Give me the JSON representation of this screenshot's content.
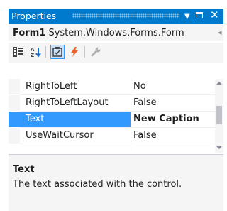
{
  "window": {
    "title": "Properties",
    "menu_glyph": "▼",
    "maximize_glyph": "□",
    "close_glyph": "✕"
  },
  "object_selector": {
    "name": "Form1",
    "type": "System.Windows.Forms.Form",
    "overflow_glyph": "◂"
  },
  "toolbar": {
    "buttons": [
      {
        "icon": "categorized-icon",
        "checked": false
      },
      {
        "icon": "alphabetical-icon",
        "checked": false
      },
      {
        "icon": "properties-icon",
        "checked": true
      },
      {
        "icon": "events-lightning-icon",
        "checked": false
      },
      {
        "icon": "property-pages-wrench-icon",
        "checked": false
      }
    ],
    "lightning_color": "#e8622a",
    "checked_border": "#3399ff",
    "checked_fill": "#c9e0f7"
  },
  "properties": [
    {
      "name": "RightToLeft",
      "value": "No",
      "selected": false
    },
    {
      "name": "RightToLeftLayout",
      "value": "False",
      "selected": false
    },
    {
      "name": "Text",
      "value": "New Caption",
      "selected": true
    },
    {
      "name": "UseWaitCursor",
      "value": "False",
      "selected": false
    }
  ],
  "description": {
    "title": "Text",
    "text": "The text associated with the control."
  },
  "colors": {
    "accent": "#007acc",
    "selection": "#3399ff",
    "panel": "#f5f5f5"
  }
}
